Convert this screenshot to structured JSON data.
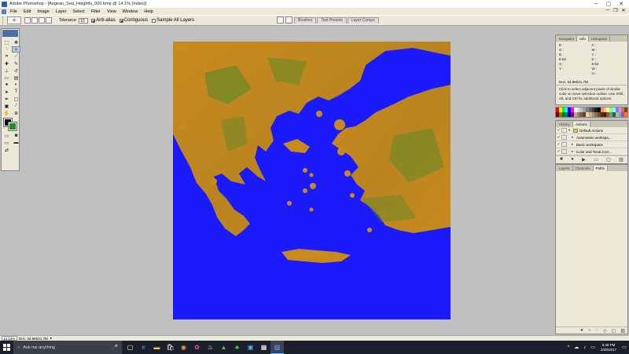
{
  "window": {
    "title": "Adobe Photoshop - [Aegean_Sea_Heightfs_000.bmp @ 14.1% (Index)]",
    "minimize": "─",
    "maximize": "▢",
    "close": "✕"
  },
  "menu": {
    "items": [
      "File",
      "Edit",
      "Image",
      "Layer",
      "Select",
      "Filter",
      "View",
      "Window",
      "Help"
    ],
    "doc_minimize": "─",
    "doc_restore": "❐",
    "doc_close": "✕"
  },
  "options": {
    "tolerance_label": "Tolerance:",
    "tolerance_value": "10",
    "anti_alias_label": "Anti-alias",
    "contiguous_label": "Contiguous",
    "sample_all_label": "Sample All Layers"
  },
  "dock_tabs": [
    "Brushes",
    "Tool Presets",
    "Layer Comps"
  ],
  "navigator_panel": {
    "tabs": [
      "Navigator",
      "Info",
      "Histogram"
    ],
    "info": {
      "left": [
        "R :",
        "G :",
        "B :",
        "8-bit",
        "X :",
        "Y :"
      ],
      "right": [
        "C :",
        "M :",
        "Y :",
        "K :",
        "8-bit",
        "W :",
        "H :"
      ]
    },
    "doc": "Doc: 34.9M/21.7M",
    "hint": "Click to select adjacent pixels of similar color or move selection outline. Use Shift, Alt, and Ctrl for additional options."
  },
  "actions_panel": {
    "tabs": [
      "History",
      "Actions"
    ],
    "rows": [
      "Default Actions",
      "Automation workspa...",
      "Basic workspace",
      "Color and Tonal Corr..."
    ]
  },
  "layers_panel": {
    "tabs": [
      "Layers",
      "Channels",
      "Paths"
    ]
  },
  "status": {
    "zoom": "14.13%",
    "doc": "Doc: 34.9M/21.7M"
  },
  "taskbar": {
    "search_placeholder": "Ask me anything",
    "time": "5:46 PM",
    "date": "2/28/2017"
  },
  "colors": {
    "sea": "#1a1afa",
    "land": "#c88a1e",
    "highland": "#5a8a2a"
  }
}
